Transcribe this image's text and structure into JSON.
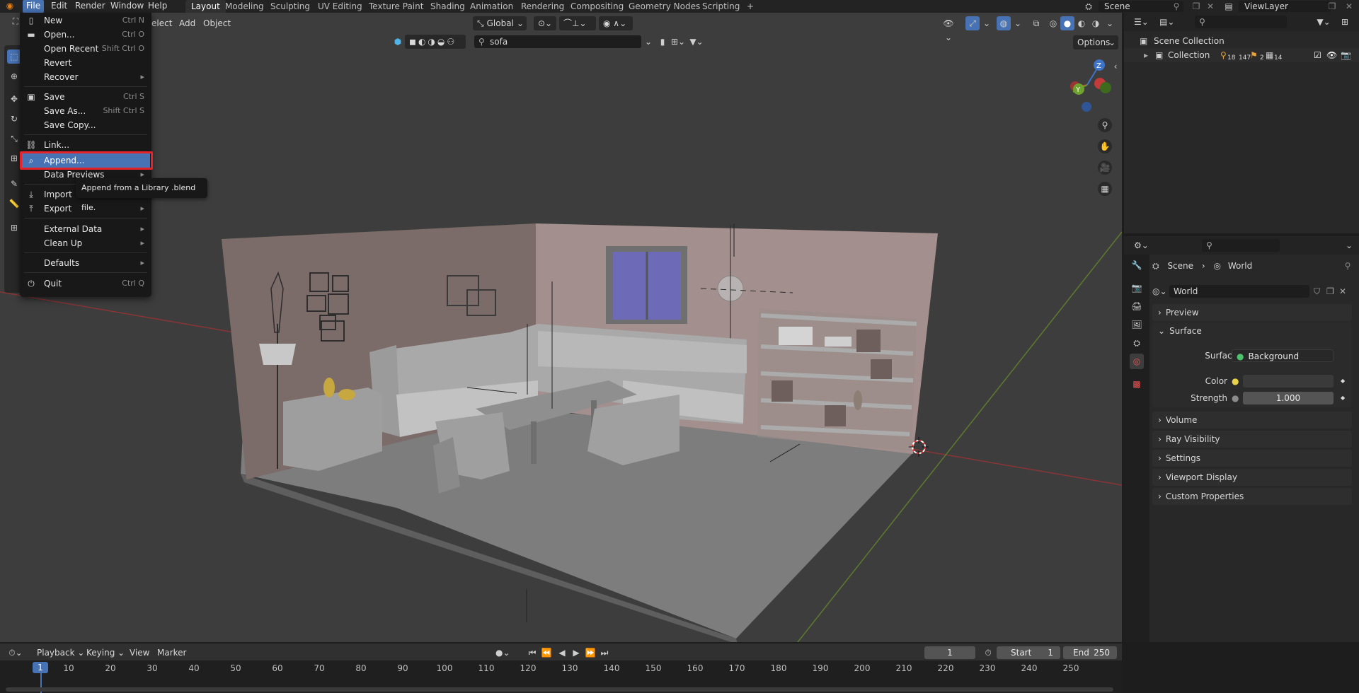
{
  "topbar": {
    "menus": [
      "File",
      "Edit",
      "Render",
      "Window",
      "Help"
    ],
    "workspaces": [
      "Layout",
      "Modeling",
      "Sculpting",
      "UV Editing",
      "Texture Paint",
      "Shading",
      "Animation",
      "Rendering",
      "Compositing",
      "Geometry Nodes",
      "Scripting"
    ],
    "add_tab": "+",
    "scene": "Scene",
    "view_layer": "ViewLayer"
  },
  "viewport_header": {
    "select": "elect",
    "add": "Add",
    "object": "Object",
    "transform": "Global",
    "search_value": "sofa",
    "options": "Options"
  },
  "file_menu": {
    "items": [
      {
        "label": "New",
        "shortcut": "Ctrl N",
        "icon": "new-file-icon"
      },
      {
        "label": "Open...",
        "shortcut": "Ctrl O",
        "icon": "folder-icon"
      },
      {
        "label": "Open Recent",
        "shortcut": "Shift Ctrl O",
        "icon": ""
      },
      {
        "label": "Revert",
        "shortcut": "",
        "icon": ""
      },
      {
        "label": "Recover",
        "shortcut": "",
        "icon": ""
      },
      {
        "label": "Save",
        "shortcut": "Ctrl S",
        "icon": "save-icon"
      },
      {
        "label": "Save As...",
        "shortcut": "Shift Ctrl S",
        "icon": ""
      },
      {
        "label": "Save Copy...",
        "shortcut": "",
        "icon": ""
      },
      {
        "label": "Link...",
        "shortcut": "",
        "icon": "link-icon"
      },
      {
        "label": "Append...",
        "shortcut": "",
        "icon": "append-icon"
      },
      {
        "label": "Data Previews",
        "shortcut": "",
        "icon": ""
      },
      {
        "label": "Import",
        "shortcut": "",
        "icon": "import-icon"
      },
      {
        "label": "Export",
        "shortcut": "",
        "icon": "export-icon"
      },
      {
        "label": "External Data",
        "shortcut": "",
        "icon": ""
      },
      {
        "label": "Clean Up",
        "shortcut": "",
        "icon": ""
      },
      {
        "label": "Defaults",
        "shortcut": "",
        "icon": ""
      },
      {
        "label": "Quit",
        "shortcut": "Ctrl Q",
        "icon": "power-icon"
      }
    ],
    "tooltip": "Append from a Library .blend file."
  },
  "outliner": {
    "scene_collection": "Scene Collection",
    "collection": "Collection",
    "counts": [
      "18",
      "147",
      "2",
      "14"
    ]
  },
  "properties": {
    "breadcrumb_scene": "Scene",
    "breadcrumb_world": "World",
    "world_name": "World",
    "sections": [
      "Preview",
      "Surface",
      "Volume",
      "Ray Visibility",
      "Settings",
      "Viewport Display",
      "Custom Properties"
    ],
    "surface_label": "Surface",
    "surface_value": "Background",
    "color_label": "Color",
    "strength_label": "Strength",
    "strength_value": "1.000"
  },
  "timeline": {
    "playback": "Playback",
    "keying": "Keying",
    "view": "View",
    "marker": "Marker",
    "current_frame": "1",
    "start_label": "Start",
    "start_value": "1",
    "end_label": "End",
    "end_value": "250",
    "ticks": [
      "1",
      "10",
      "20",
      "30",
      "40",
      "50",
      "60",
      "70",
      "80",
      "90",
      "100",
      "110",
      "120",
      "130",
      "140",
      "150",
      "160",
      "170",
      "180",
      "190",
      "200",
      "210",
      "220",
      "230",
      "240",
      "250"
    ]
  },
  "gizmo": {
    "x": "X",
    "y": "Y",
    "z": "Z"
  }
}
